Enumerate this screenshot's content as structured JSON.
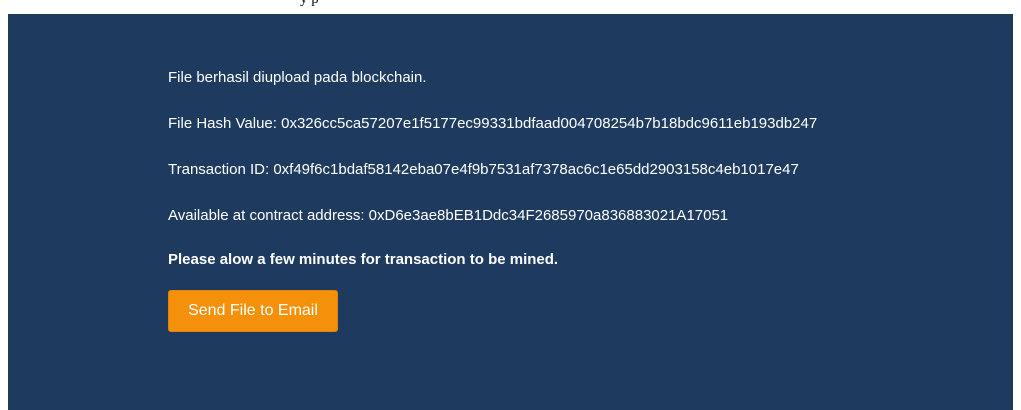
{
  "top_text": "y  p",
  "messages": {
    "upload_status": "File berhasil diupload pada blockchain.",
    "file_hash": "File Hash Value: 0x326cc5ca57207e1f5177ec99331bdfaad004708254b7b18bdc9611eb193db247",
    "transaction_id": "Transaction ID: 0xf49f6c1bdaf58142eba07e4f9b7531af7378ac6c1e65dd2903158c4eb1017e47",
    "contract_address": "Available at contract address: 0xD6e3ae8bEB1Ddc34F2685970a836883021A17051",
    "mining_notice": "Please alow a few minutes for transaction to be mined."
  },
  "actions": {
    "send_email_label": "Send File to Email"
  },
  "colors": {
    "panel_background": "#1e3a5f",
    "button_background": "#f5900a",
    "text": "#ffffff"
  }
}
